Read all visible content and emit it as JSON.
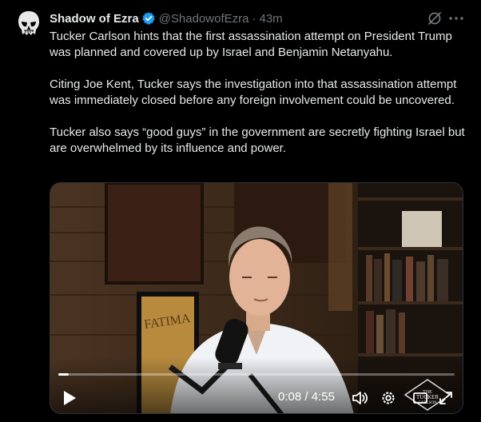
{
  "author": {
    "name": "Shadow of Ezra",
    "handle": "@ShadowofEzra",
    "separator": "·",
    "time": "43m"
  },
  "tweet": {
    "paragraphs": [
      "Tucker Carlson hints that the first assassination attempt on President Trump was planned and covered up by Israel and Benjamin Netanyahu.",
      "Citing Joe Kent, Tucker says the investigation into that assassination attempt was immediately closed before any foreign involvement could be uncovered.",
      "Tucker also says “good guys” in the government are secretly fighting Israel but are overwhelmed by its influence and power."
    ]
  },
  "video": {
    "current_time": "0:08",
    "duration": "4:55",
    "time_separator": "/",
    "progress": 0.027,
    "poster_text": "FATIMA",
    "watermark": "THE TUCKER CARLSON NETWORK"
  },
  "colors": {
    "background": "#000000",
    "text": "#e7e9ea",
    "muted": "#71767b",
    "verified": "#1d9bf0"
  },
  "icons": [
    "skull-avatar",
    "verified-badge-icon",
    "grok-icon",
    "more-icon",
    "play-icon",
    "volume-icon",
    "settings-icon",
    "fullscreen-icon"
  ]
}
